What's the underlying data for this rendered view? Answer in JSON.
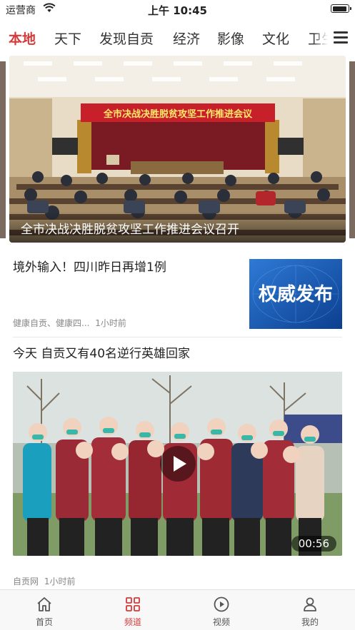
{
  "status_bar": {
    "carrier": "运营商",
    "time": "上午 10:45"
  },
  "channel_tabs": [
    {
      "label": "本地",
      "active": true
    },
    {
      "label": "天下",
      "active": false
    },
    {
      "label": "发现自贡",
      "active": false
    },
    {
      "label": "经济",
      "active": false
    },
    {
      "label": "影像",
      "active": false
    },
    {
      "label": "文化",
      "active": false
    },
    {
      "label": "卫生",
      "active": false
    }
  ],
  "banner": {
    "slide_title": "全市决战决胜脱贫攻坚工作推进会议召开",
    "stage_sign": "全市决战决胜脱贫攻坚工作推进会议"
  },
  "news": [
    {
      "title": "境外输入！四川昨日再增1例",
      "source": "健康自贡、健康四...",
      "time": "1小时前",
      "thumb_text": "权威发布"
    },
    {
      "title": "今天 自贡又有40名逆行英雄回家",
      "source": "自贡网",
      "time": "1小时前",
      "duration": "00:56"
    }
  ],
  "tab_bar": [
    {
      "label": "首页",
      "icon": "home-icon",
      "active": false
    },
    {
      "label": "频道",
      "icon": "grid-icon",
      "active": true
    },
    {
      "label": "视频",
      "icon": "play-circle-icon",
      "active": false
    },
    {
      "label": "我的",
      "icon": "user-icon",
      "active": false
    }
  ],
  "colors": {
    "accent": "#d63a3a",
    "thumb_blue": "#1a5fb4"
  }
}
